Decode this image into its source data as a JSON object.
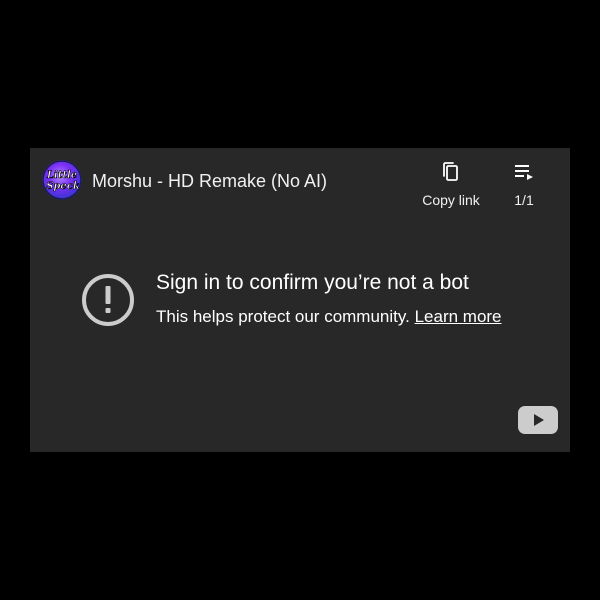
{
  "video": {
    "title": "Morshu - HD Remake (No AI)",
    "channel_avatar": {
      "text_line1": "Little",
      "text_line2": "Speck",
      "icon": "channel-avatar-logo"
    }
  },
  "toolbar": {
    "copy_link": {
      "label": "Copy link",
      "icon": "copy-icon"
    },
    "playlist": {
      "label": "1/1",
      "icon": "playlist-icon"
    }
  },
  "error": {
    "icon": "exclamation-circle-icon",
    "heading": "Sign in to confirm you’re not a bot",
    "message": "This helps protect our community.",
    "link_label": "Learn more"
  },
  "branding": {
    "icon": "youtube-logo-icon"
  },
  "colors": {
    "page_background": "#000000",
    "player_background": "#282828",
    "text": "#ffffff",
    "icon_grey": "#cccccc",
    "avatar_purple": "#7b2ff7",
    "avatar_blue": "#3a4de0"
  }
}
